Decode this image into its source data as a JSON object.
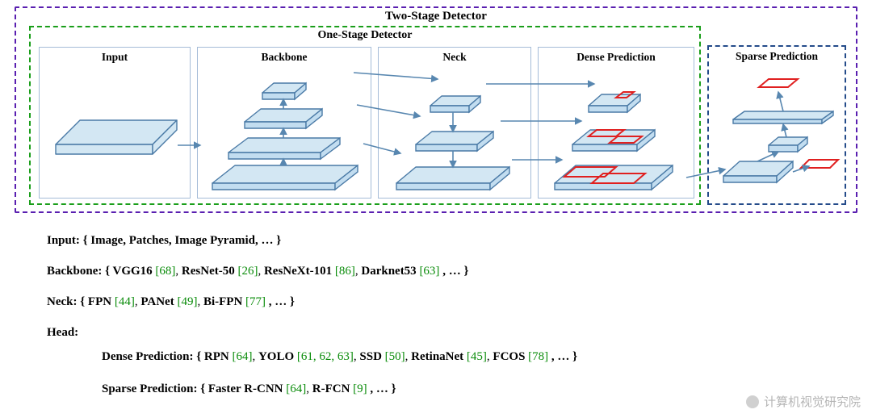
{
  "diagram": {
    "outer_title": "Two-Stage Detector",
    "inner_title": "One-Stage Detector",
    "panels": {
      "input": "Input",
      "backbone": "Backbone",
      "neck": "Neck",
      "dense": "Dense Prediction",
      "sparse": "Sparse Prediction"
    }
  },
  "legend": {
    "input_label": "Input: { Image, Patches, Image Pyramid, … }",
    "backbone_label": "Backbone: { ",
    "backbone_items": [
      {
        "name": "VGG16 ",
        "ref": "[68]"
      },
      {
        "sep": ", ",
        "name": "ResNet-50 ",
        "ref": "[26]"
      },
      {
        "sep": ", ",
        "name": "ResNeXt-101 ",
        "ref": "[86]"
      },
      {
        "sep": ", ",
        "name": "Darknet53 ",
        "ref": "[63]"
      }
    ],
    "backbone_tail": ", … }",
    "neck_label": "Neck: { ",
    "neck_items": [
      {
        "name": "FPN ",
        "ref": "[44]"
      },
      {
        "sep": ", ",
        "name": "PANet ",
        "ref": "[49]"
      },
      {
        "sep": ", ",
        "name": "Bi-FPN ",
        "ref": "[77]"
      }
    ],
    "neck_tail": ", … }",
    "head_label": "Head:",
    "dense_label": "Dense Prediction: { ",
    "dense_items": [
      {
        "name": "RPN ",
        "ref": "[64]"
      },
      {
        "sep": ", ",
        "name": "YOLO ",
        "ref": "[61, 62, 63]"
      },
      {
        "sep": ", ",
        "name": "SSD ",
        "ref": "[50]"
      },
      {
        "sep": ", ",
        "name": "RetinaNet ",
        "ref": "[45]"
      },
      {
        "sep": ", ",
        "name": "FCOS ",
        "ref": "[78]"
      }
    ],
    "dense_tail": ", … }",
    "sparse_label": "Sparse Prediction: { ",
    "sparse_items": [
      {
        "name": "Faster R-CNN ",
        "ref": "[64]"
      },
      {
        "sep": ",  ",
        "name": "R-FCN ",
        "ref": "[9]"
      }
    ],
    "sparse_tail": ", … }"
  },
  "watermark": "计算机视觉研究院"
}
